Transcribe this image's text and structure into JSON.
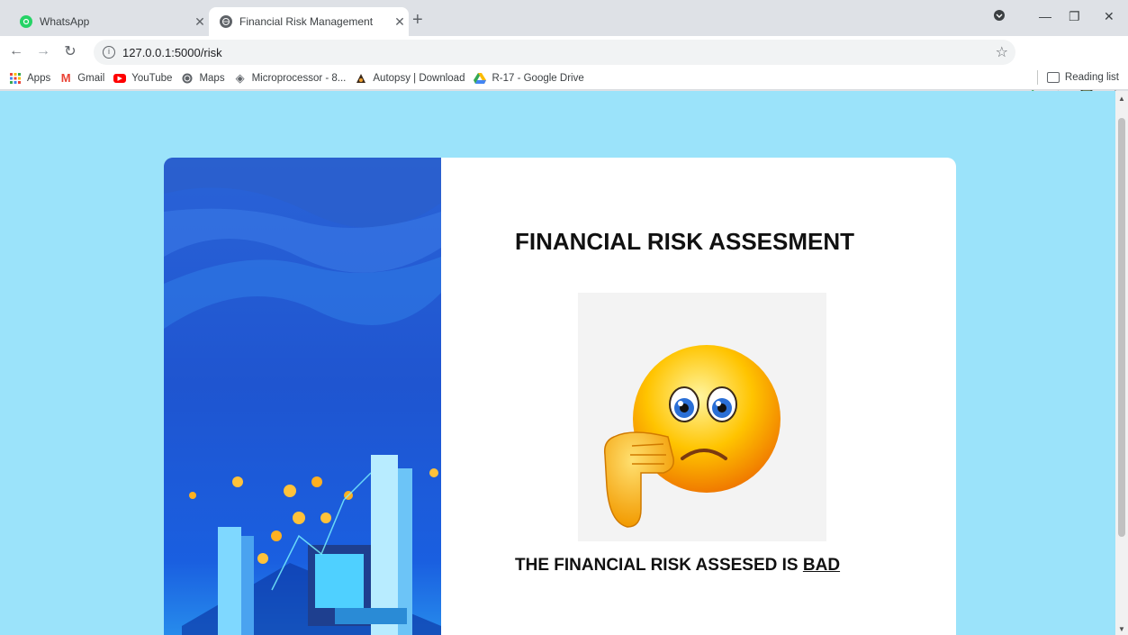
{
  "browser": {
    "tabs": [
      {
        "title": "WhatsApp",
        "icon": "whatsapp-icon",
        "active": false
      },
      {
        "title": "Financial Risk Management",
        "icon": "globe-icon",
        "active": true
      }
    ],
    "url": "127.0.0.1:5000/risk",
    "bookmarks": [
      {
        "label": "Apps",
        "icon": "apps-grid-icon"
      },
      {
        "label": "Gmail",
        "icon": "gmail-icon"
      },
      {
        "label": "YouTube",
        "icon": "youtube-icon"
      },
      {
        "label": "Maps",
        "icon": "globe-icon"
      },
      {
        "label": "Microprocessor - 8...",
        "icon": "microprocessor-icon"
      },
      {
        "label": "Autopsy | Download",
        "icon": "autopsy-icon"
      },
      {
        "label": "R-17 - Google Drive",
        "icon": "google-drive-icon"
      }
    ],
    "reading_list": "Reading list"
  },
  "page": {
    "heading": "FINANCIAL RISK ASSESMENT",
    "result_prefix": "THE FINANCIAL RISK ASSESED IS",
    "result_value": "BAD",
    "image": "sad-thumbs-down-emoji",
    "background_color": "#9be3fa",
    "panel_color": "#1f55d0"
  }
}
